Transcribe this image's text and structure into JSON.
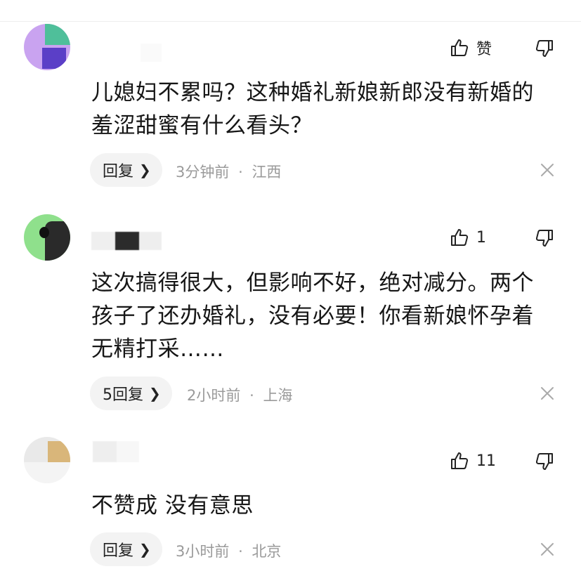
{
  "comments": [
    {
      "avatar_colors": [
        "#c9a3f0",
        "#4fbf9a",
        "#5b3fc7",
        "#e8e0f8"
      ],
      "like_label": "赞",
      "text": "儿媳妇不累吗？这种婚礼新娘新郎没有新婚的羞涩甜蜜有什么看头？",
      "reply_label": "回复",
      "time": "3分钟前",
      "location": "江西",
      "separator": "·"
    },
    {
      "avatar_colors": [
        "#8fe08c",
        "#2a2a2a"
      ],
      "like_label": "1",
      "text": "这次搞得很大，但影响不好，绝对减分。两个孩子了还办婚礼，没有必要！你看新娘怀孕着无精打采……",
      "reply_label": "5回复",
      "time": "2小时前",
      "location": "上海",
      "separator": "·"
    },
    {
      "avatar_colors": [
        "#e9e9e9",
        "#d9b67a",
        "#f4f4f4"
      ],
      "like_label": "11",
      "text": "不赞成 没有意思",
      "reply_label": "回复",
      "time": "3小时前",
      "location": "北京",
      "separator": "·"
    }
  ],
  "icons": {
    "like": "thumbs-up-icon",
    "dislike": "thumbs-down-icon",
    "chevron": "chevron-right-icon",
    "close": "close-icon"
  }
}
